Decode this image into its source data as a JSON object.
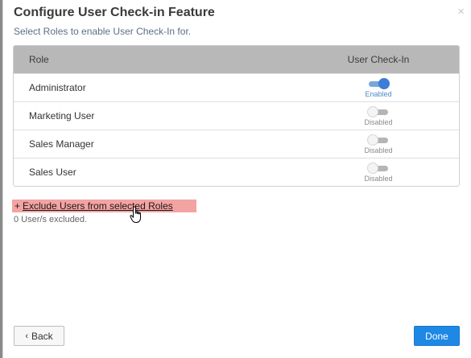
{
  "dialog": {
    "title": "Configure User Check-in Feature",
    "subtitle": "Select Roles to enable User Check-In for.",
    "close_icon": "×"
  },
  "table": {
    "headers": [
      "Role",
      "User Check-In"
    ],
    "rows": [
      {
        "role": "Administrator",
        "status": "Enabled",
        "enabled": true
      },
      {
        "role": "Marketing User",
        "status": "Disabled",
        "enabled": false
      },
      {
        "role": "Sales Manager",
        "status": "Disabled",
        "enabled": false
      },
      {
        "role": "Sales User",
        "status": "Disabled",
        "enabled": false
      }
    ]
  },
  "exclude": {
    "prefix": "+",
    "label": "Exclude Users from selected Roles",
    "count_text": "0 User/s excluded."
  },
  "footer": {
    "back_icon": "‹",
    "back_label": "Back",
    "done_label": "Done"
  },
  "colors": {
    "accent": "#1e88e5",
    "highlight": "#f4a3a3",
    "header_bg": "#b8b8b8"
  }
}
